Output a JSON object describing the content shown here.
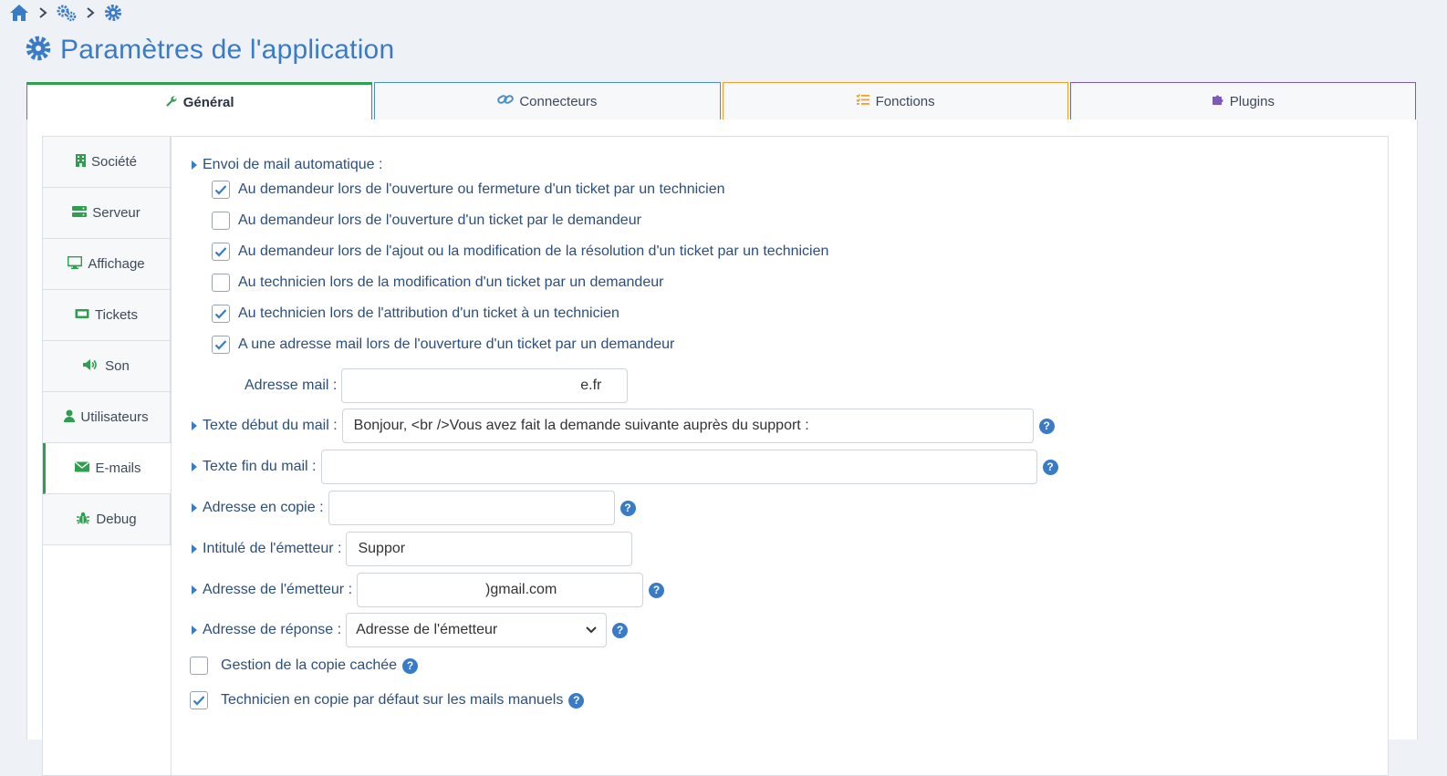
{
  "page": {
    "title": "Paramètres de l'application"
  },
  "tabs": [
    {
      "label": "Général",
      "active": true,
      "color": "#2e9e4f",
      "icon": "wrench-icon"
    },
    {
      "label": "Connecteurs",
      "color": "#4a90c8",
      "icon": "link-icon"
    },
    {
      "label": "Fonctions",
      "color": "#f0a030",
      "icon": "list-check-icon"
    },
    {
      "label": "Plugins",
      "color": "#7b5ab8",
      "icon": "puzzle-icon"
    }
  ],
  "sidebar": [
    {
      "label": "Société",
      "icon": "building-icon"
    },
    {
      "label": "Serveur",
      "icon": "server-icon"
    },
    {
      "label": "Affichage",
      "icon": "desktop-icon"
    },
    {
      "label": "Tickets",
      "icon": "ticket-icon"
    },
    {
      "label": "Son",
      "icon": "volume-icon"
    },
    {
      "label": "Utilisateurs",
      "icon": "user-icon"
    },
    {
      "label": "E-mails",
      "icon": "envelope-icon",
      "active": true
    },
    {
      "label": "Debug",
      "icon": "bug-icon"
    }
  ],
  "mail": {
    "auto_label": "Envoi de mail automatique :",
    "options": [
      {
        "label": "Au demandeur lors de l'ouverture ou fermeture d'un ticket par un technicien",
        "checked": true
      },
      {
        "label": "Au demandeur lors de l'ouverture d'un ticket par le demandeur",
        "checked": false
      },
      {
        "label": "Au demandeur lors de l'ajout ou la modification de la résolution d'un ticket par un technicien",
        "checked": true
      },
      {
        "label": "Au technicien lors de la modification d'un ticket par un demandeur",
        "checked": false
      },
      {
        "label": "Au technicien lors de l'attribution d'un ticket à un technicien",
        "checked": true
      },
      {
        "label": "A une adresse mail lors de l'ouverture d'un ticket par un demandeur",
        "checked": true
      }
    ],
    "address_label": "Adresse mail :",
    "address_value": "e.fr",
    "start_text_label": "Texte début du mail :",
    "start_text_value": "Bonjour, <br />Vous avez fait la demande suivante auprès du support :",
    "end_text_label": "Texte fin du mail :",
    "end_text_value": "",
    "cc_label": "Adresse en copie :",
    "cc_value": "",
    "sender_name_label": "Intitulé de l'émetteur :",
    "sender_name_value": "Suppor",
    "sender_address_label": "Adresse de l'émetteur :",
    "sender_address_value": ")gmail.com",
    "reply_label": "Adresse de réponse :",
    "reply_value": "Adresse de l'émetteur",
    "bcc_label": "Gestion de la copie cachée",
    "bcc_checked": false,
    "tech_cc_label": "Technicien en copie par défaut sur les mails manuels",
    "tech_cc_checked": true,
    "help_glyph": "?"
  }
}
